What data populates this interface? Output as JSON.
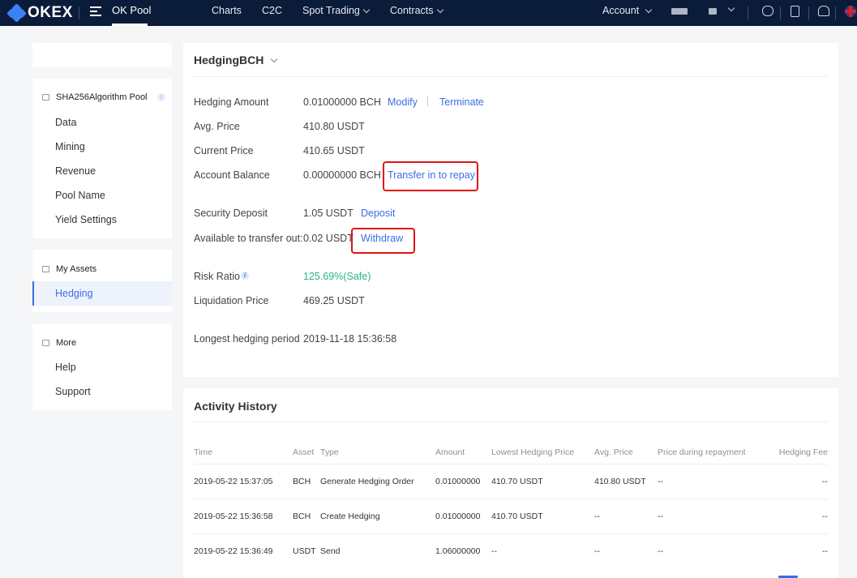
{
  "topbar": {
    "logo_text": "OKEX",
    "product": "OK Pool",
    "nav": [
      {
        "label": "Charts"
      },
      {
        "label": "C2C"
      },
      {
        "label": "Spot Trading"
      },
      {
        "label": "Contracts"
      }
    ],
    "account_label": "Account"
  },
  "sidebar": {
    "pool_section": {
      "title": "SHA256Algorithm Pool",
      "items": [
        "Data",
        "Mining",
        "Revenue",
        "Pool Name",
        "Yield Settings"
      ]
    },
    "assets_section": {
      "title": "My Assets",
      "items": [
        "Hedging"
      ]
    },
    "more_section": {
      "title": "More",
      "items": [
        "Help",
        "Support"
      ]
    }
  },
  "hedging": {
    "title": "HedgingBCH",
    "rows": {
      "amount": {
        "label": "Hedging Amount",
        "value": "0.01000000 BCH",
        "action1": "Modify",
        "action2": "Terminate"
      },
      "avg_price": {
        "label": "Avg. Price",
        "value": "410.80 USDT"
      },
      "current_price": {
        "label": "Current Price",
        "value": "410.65 USDT"
      },
      "account_balance": {
        "label": "Account Balance",
        "value": "0.00000000 BCH",
        "action": "Transfer in to repay"
      },
      "security_deposit": {
        "label": "Security Deposit",
        "value": "1.05 USDT",
        "action": "Deposit"
      },
      "available_out": {
        "label": "Available to transfer out:",
        "value": "0.02 USDT",
        "action": "Withdraw"
      },
      "risk_ratio": {
        "label": "Risk Ratio",
        "value": "125.69%(Safe)"
      },
      "liquidation_price": {
        "label": "Liquidation Price",
        "value": "469.25 USDT"
      },
      "longest_period": {
        "label": "Longest hedging period",
        "value": "2019-11-18 15:36:58"
      }
    }
  },
  "activity": {
    "title": "Activity History",
    "columns": [
      "Time",
      "Asset",
      "Type",
      "Amount",
      "Lowest Hedging Price",
      "Avg. Price",
      "Price during repayment",
      "Hedging Fee"
    ],
    "rows": [
      [
        "2019-05-22 15:37:05",
        "BCH",
        "Generate Hedging Order",
        "0.01000000",
        "410.70 USDT",
        "410.80 USDT",
        "--",
        "--"
      ],
      [
        "2019-05-22 15:36:58",
        "BCH",
        "Create Hedging",
        "0.01000000",
        "410.70 USDT",
        "--",
        "--",
        "--"
      ],
      [
        "2019-05-22 15:36:49",
        "USDT",
        "Send",
        "1.06000000",
        "--",
        "--",
        "--",
        "--"
      ]
    ]
  },
  "colors": {
    "topbar_bg": "#0b1b3a",
    "link": "#3a6fe3",
    "safe": "#2db67c",
    "highlight_box": "#e01414"
  }
}
